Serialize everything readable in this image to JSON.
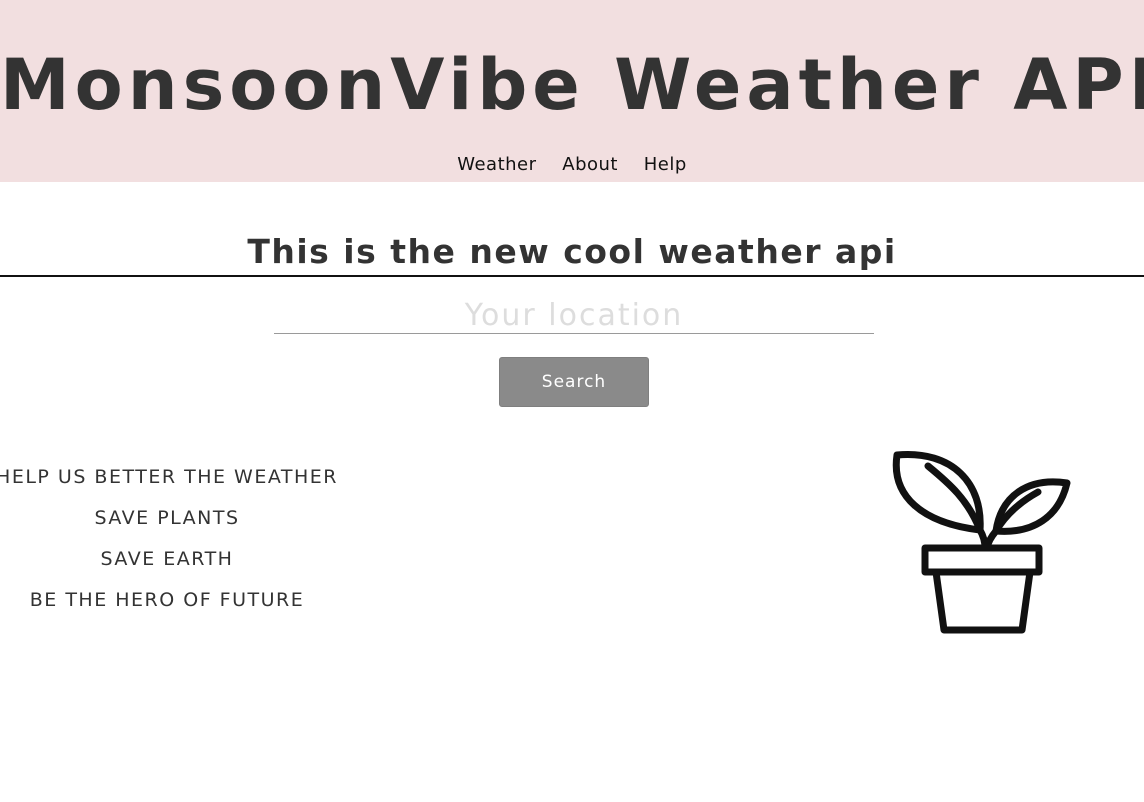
{
  "header": {
    "title": "MonsoonVibe Weather API",
    "nav": [
      "Weather",
      "About",
      "Help"
    ]
  },
  "main": {
    "tagline": "This is the new cool weather api",
    "search": {
      "placeholder": "Your location",
      "value": "",
      "button_label": "Search"
    },
    "slogans": [
      "HELP US BETTER THE WEATHER",
      "SAVE PLANTS",
      "SAVE EARTH",
      "BE THE HERO OF FUTURE"
    ],
    "illustration_icon": "potted-plant-icon"
  },
  "colors": {
    "header_background": "#f2dfe0",
    "text": "#333333",
    "button_background": "#8a8a8a",
    "button_text": "#ffffff",
    "placeholder": "#dddddd"
  }
}
